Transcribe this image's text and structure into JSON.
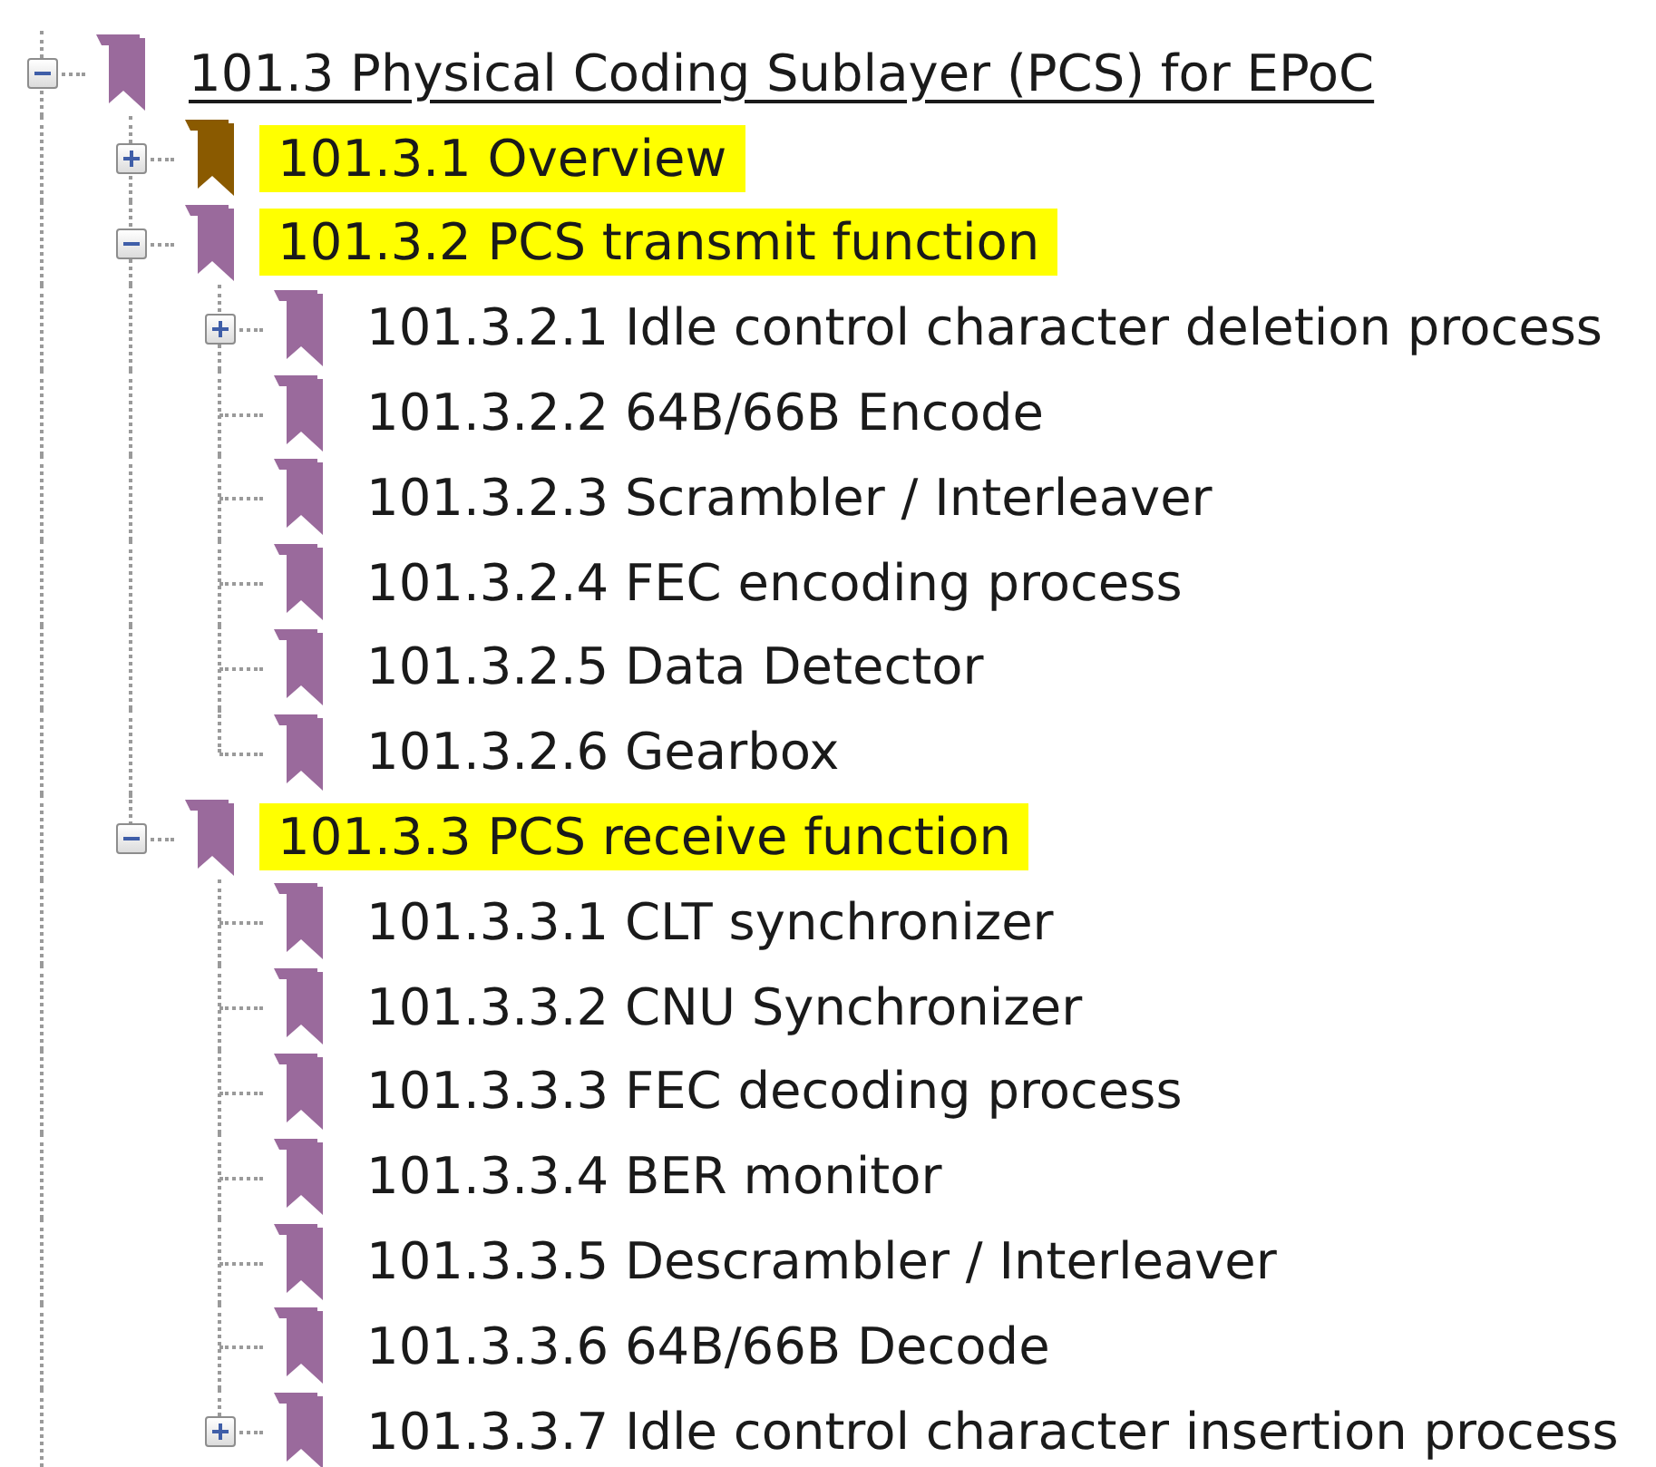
{
  "bookmarks": [
    {
      "label": "101.3 Physical Coding Sublayer (PCS) for EPoC",
      "expanded": true,
      "selected": true,
      "highlighted": false,
      "current": false,
      "children": [
        {
          "label": "101.3.1 Overview",
          "expanded": false,
          "selected": false,
          "highlighted": true,
          "current": true
        },
        {
          "label": "101.3.2 PCS transmit function",
          "expanded": true,
          "selected": false,
          "highlighted": true,
          "current": false,
          "children": [
            {
              "label": "101.3.2.1 Idle control character deletion process",
              "expanded": false,
              "selected": false,
              "highlighted": false,
              "current": false
            },
            {
              "label": "101.3.2.2 64B/66B Encode",
              "selected": false,
              "highlighted": false,
              "current": false
            },
            {
              "label": "101.3.2.3 Scrambler / Interleaver",
              "selected": false,
              "highlighted": false,
              "current": false
            },
            {
              "label": "101.3.2.4 FEC encoding process",
              "selected": false,
              "highlighted": false,
              "current": false
            },
            {
              "label": "101.3.2.5 Data Detector",
              "selected": false,
              "highlighted": false,
              "current": false
            },
            {
              "label": "101.3.2.6 Gearbox",
              "selected": false,
              "highlighted": false,
              "current": false
            }
          ]
        },
        {
          "label": "101.3.3 PCS receive function",
          "expanded": true,
          "selected": false,
          "highlighted": true,
          "current": false,
          "children": [
            {
              "label": "101.3.3.1 CLT synchronizer",
              "selected": false,
              "highlighted": false,
              "current": false
            },
            {
              "label": "101.3.3.2 CNU Synchronizer",
              "selected": false,
              "highlighted": false,
              "current": false
            },
            {
              "label": "101.3.3.3 FEC decoding process",
              "selected": false,
              "highlighted": false,
              "current": false
            },
            {
              "label": "101.3.3.4 BER monitor",
              "selected": false,
              "highlighted": false,
              "current": false
            },
            {
              "label": "101.3.3.5 Descrambler / Interleaver",
              "selected": false,
              "highlighted": false,
              "current": false
            },
            {
              "label": "101.3.3.6 64B/66B Decode",
              "selected": false,
              "highlighted": false,
              "current": false
            },
            {
              "label": "101.3.3.7 Idle control character insertion process",
              "expanded": false,
              "selected": false,
              "highlighted": false,
              "current": false
            }
          ]
        }
      ]
    }
  ]
}
